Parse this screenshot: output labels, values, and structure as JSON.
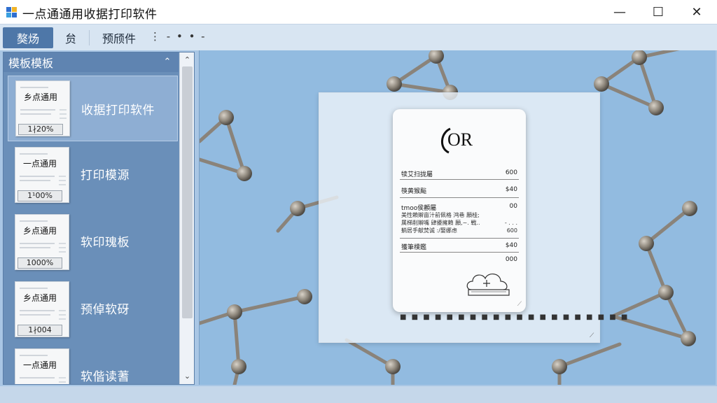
{
  "window": {
    "title": "一点通通用收据打印软件",
    "minimize_glyph": "—",
    "maximize_glyph": "☐",
    "close_glyph": "✕"
  },
  "toolbar": {
    "tab1": "獒炀",
    "tab2": "贠",
    "tab3": "预颀件",
    "more": "⋮ - • • -"
  },
  "left_panel": {
    "header": "模板模板",
    "collapse_glyph": "⌃",
    "scroll_up_glyph": "⌃",
    "scroll_down_glyph": "⌄",
    "items": [
      {
        "thumb_title": "乡点通用",
        "zoom": "1∤20%",
        "name": "收据打印软件",
        "selected": true
      },
      {
        "thumb_title": "一点通用",
        "zoom": "1¹00%",
        "name": "打印模源",
        "selected": false
      },
      {
        "thumb_title": "乡点通用",
        "zoom": "1000%",
        "name": "软印瑰板",
        "selected": false
      },
      {
        "thumb_title": "乡点通用",
        "zoom": "1∤004",
        "name": "预倬软砑",
        "selected": false
      },
      {
        "thumb_title": "一点通用",
        "zoom": "",
        "name": "软偕读蓍",
        "selected": false
      }
    ]
  },
  "receipt": {
    "logo": "OR",
    "rows": [
      {
        "label": "犊艾扫拢屬",
        "value": "600"
      },
      {
        "label": "筷黄猴颭",
        "value": "$40"
      },
      {
        "label": "tmoo侯顴屬",
        "value": "00"
      }
    ],
    "small_lines": [
      {
        "text": "美性賴辮亩汁前佩格 鸿巷 願桂;",
        "value": ""
      },
      {
        "text": "属梯削辮嘴 肆擾擁賴 願,~. 戦..",
        "value": "- . . ."
      },
      {
        "text": "躺居手献焚诚 :/娶娜虑",
        "value": "600"
      }
    ],
    "total_row": {
      "label": "獲筆樸鑑",
      "value": "$40"
    },
    "extra_value": "000",
    "dots": "■ ■ ■ ■ ■ ■ ■ ■ ■ ■ ■ ■ ■ ■ ■ ■ ■ ■ ■ ■"
  },
  "colors": {
    "accent": "#4e77a8",
    "panel": "#6a8fb9",
    "preview_bg": "#8fb8de"
  }
}
